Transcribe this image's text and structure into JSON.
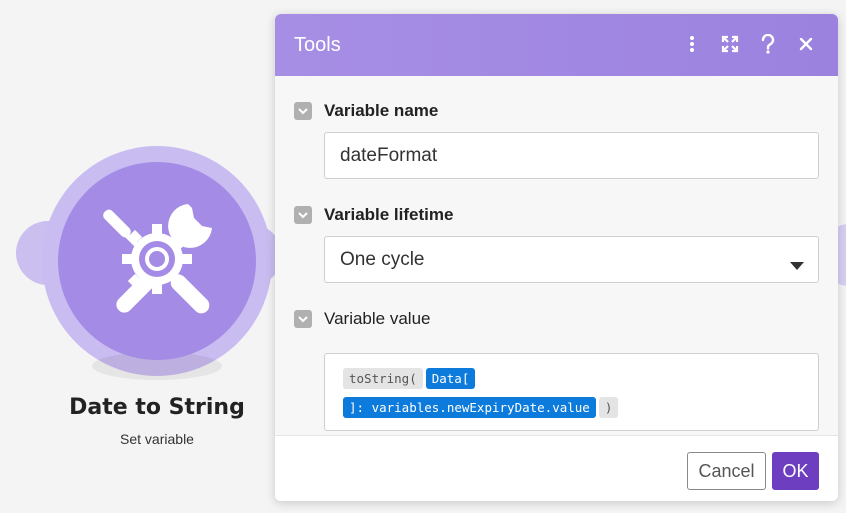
{
  "module": {
    "title": "Date to String",
    "subtitle": "Set variable",
    "icon": "tools-icon"
  },
  "dialog": {
    "title": "Tools",
    "header_icons": [
      "more-vertical-icon",
      "expand-icon",
      "help-icon",
      "close-icon"
    ],
    "sections": {
      "variable_name": {
        "label": "Variable name",
        "value": "dateFormat"
      },
      "variable_lifetime": {
        "label": "Variable lifetime",
        "selected": "One cycle"
      },
      "variable_value": {
        "label": "Variable value",
        "line1": {
          "fn_open": "toString(",
          "pill_start": "Data["
        },
        "line2": {
          "pill_end": "]: variables.newExpiryDate.value",
          "fn_close": ")"
        }
      }
    },
    "footer": {
      "cancel_label": "Cancel",
      "ok_label": "OK"
    }
  },
  "colors": {
    "header": "#a78ee5",
    "module": "#a48ce6",
    "pill": "#0d7bdc",
    "ok_button": "#6d3fc0"
  }
}
